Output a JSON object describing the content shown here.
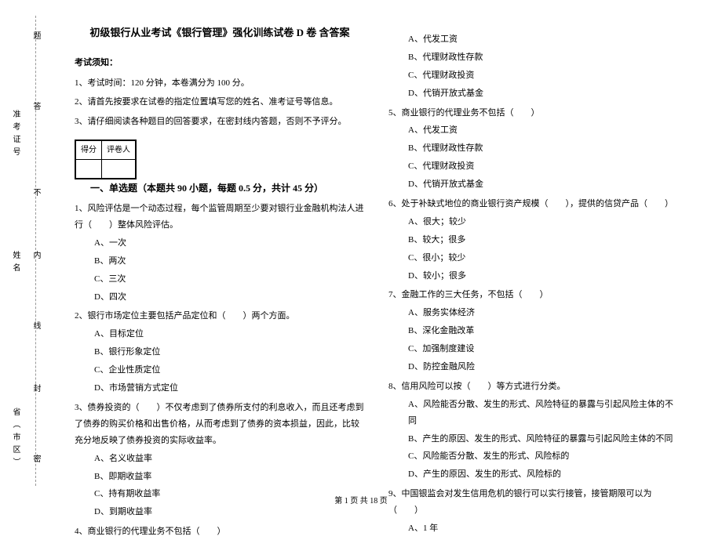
{
  "binding": {
    "province": "省（市区）",
    "name": "姓名",
    "ticket": "准考证号",
    "seal": "密",
    "cut": "封",
    "line": "线",
    "inner": "内",
    "no": "不",
    "answer": "答",
    "question": "题"
  },
  "header": {
    "title": "初级银行从业考试《银行管理》强化训练试卷 D 卷  含答案"
  },
  "notice": {
    "label": "考试须知：",
    "item1": "1、考试时间：120 分钟，本卷满分为 100 分。",
    "item2": "2、请首先按要求在试卷的指定位置填写您的姓名、准考证号等信息。",
    "item3": "3、请仔细阅读各种题目的回答要求，在密封线内答题，否则不予评分。"
  },
  "scorebox": {
    "score": "得分",
    "grader": "评卷人"
  },
  "section1": {
    "title": "一、单选题（本题共 90 小题，每题 0.5 分，共计 45 分）"
  },
  "q1": {
    "stem": "1、风险评估是一个动态过程，每个监管周期至少要对银行业金融机构法人进行（　　）整体风险评估。",
    "a": "A、一次",
    "b": "B、两次",
    "c": "C、三次",
    "d": "D、四次"
  },
  "q2": {
    "stem": "2、银行市场定位主要包括产品定位和（　　）两个方面。",
    "a": "A、目标定位",
    "b": "B、银行形象定位",
    "c": "C、企业性质定位",
    "d": "D、市场营销方式定位"
  },
  "q3": {
    "stem": "3、债券投资的（　　）不仅考虑到了债券所支付的利息收入，而且还考虑到了债券的购买价格和出售价格，从而考虑到了债券的资本损益，因此，比较充分地反映了债券投资的实际收益率。",
    "a": "A、名义收益率",
    "b": "B、即期收益率",
    "c": "C、持有期收益率",
    "d": "D、到期收益率"
  },
  "q4": {
    "stem": "4、商业银行的代理业务不包括（　　）",
    "a": "A、代发工资",
    "b": "B、代理财政性存款",
    "c": "C、代理财政投资",
    "d": "D、代销开放式基金"
  },
  "q5": {
    "stem": "5、商业银行的代理业务不包括（　　）",
    "a": "A、代发工资",
    "b": "B、代理财政性存款",
    "c": "C、代理财政投资",
    "d": "D、代销开放式基金"
  },
  "q6": {
    "stem": "6、处于补缺式地位的商业银行资产规模（　　），提供的信贷产品（　　）",
    "a": "A、很大；较少",
    "b": "B、较大；很多",
    "c": "C、很小；较少",
    "d": "D、较小；很多"
  },
  "q7": {
    "stem": "7、金融工作的三大任务，不包括（　　）",
    "a": "A、服务实体经济",
    "b": "B、深化金融改革",
    "c": "C、加强制度建设",
    "d": "D、防控金融风险"
  },
  "q8": {
    "stem": "8、信用风险可以按（　　）等方式进行分类。",
    "a": "A、风险能否分散、发生的形式、风险特征的暴露与引起风险主体的不同",
    "b": "B、产生的原因、发生的形式、风险特征的暴露与引起风险主体的不同",
    "c": "C、风险能否分散、发生的形式、风险标的",
    "d": "D、产生的原因、发生的形式、风险标的"
  },
  "q9": {
    "stem": "9、中国银监会对发生信用危机的银行可以实行接管，接管期限可以为（　　）",
    "a": "A、1 年"
  },
  "footer": {
    "pagenum": "第 1 页 共 18 页"
  }
}
